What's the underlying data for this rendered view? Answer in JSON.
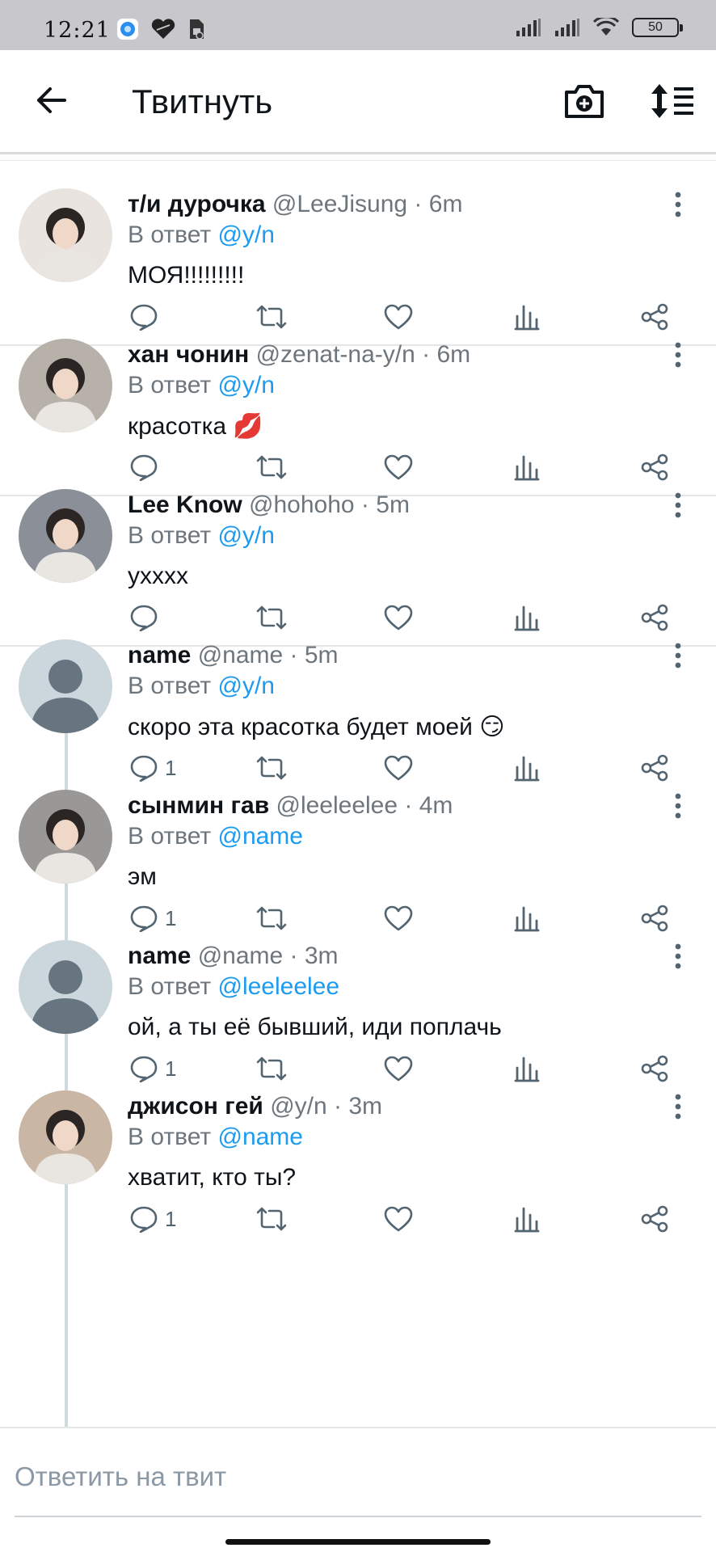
{
  "status_bar": {
    "time": "12:21",
    "battery": "50"
  },
  "header": {
    "title": "Твитнуть"
  },
  "reply_prefix": "В ответ",
  "tweets": [
    {
      "name": "т/и дурочка",
      "meta": "@LeeJisung · 6m",
      "reply_to": "@y/n",
      "text": "МОЯ!!!!!!!!!",
      "reply_count": "",
      "avatar_bg": "#e9e4df"
    },
    {
      "name": "хан чонин",
      "meta": "@zenat-na-y/n · 6m",
      "reply_to": "@y/n",
      "text": "красотка 💋",
      "reply_count": "",
      "avatar_bg": "#b7b1a9"
    },
    {
      "name": "Lee Know",
      "meta": "@hohoho · 5m",
      "reply_to": "@y/n",
      "text": "уxxxx",
      "reply_count": "",
      "avatar_bg": "#8b8f98"
    },
    {
      "name": "name",
      "meta": "@name · 5m",
      "reply_to": "@y/n",
      "text": "скоро эта красотка будет моей 😏",
      "reply_count": "1",
      "avatar_bg": "#ccd6dd"
    },
    {
      "name": "сынмин гав",
      "meta": "@leeleelee · 4m",
      "reply_to": "@name",
      "text": "эм",
      "reply_count": "1",
      "avatar_bg": "#9a9896"
    },
    {
      "name": "name",
      "meta": "@name · 3m",
      "reply_to": "@leeleelee",
      "text": "ой, а ты её бывший, иди поплачь",
      "reply_count": "1",
      "avatar_bg": "#ccd6dd"
    },
    {
      "name": "джисон гей",
      "meta": "@y/n · 3m",
      "reply_to": "@name",
      "text": "хватит, кто ты?",
      "reply_count": "1",
      "avatar_bg": "#c9b6a4"
    }
  ],
  "reply_bar": {
    "placeholder": "Ответить на твит"
  },
  "colors": {
    "link": "#1d9bf0",
    "muted": "#6e767d",
    "icon": "#536471"
  }
}
